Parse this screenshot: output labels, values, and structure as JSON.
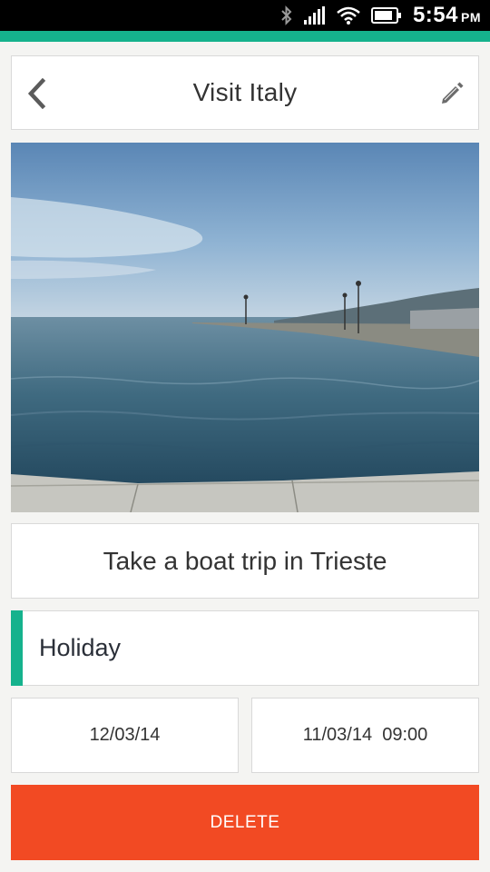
{
  "status_bar": {
    "time": "5:54",
    "ampm": "PM",
    "icons": [
      "bluetooth-icon",
      "signal-icon",
      "wifi-icon",
      "battery-icon"
    ]
  },
  "colors": {
    "accent": "#15b28d",
    "delete": "#f24a23",
    "background": "#f4f4f2"
  },
  "header": {
    "title": "Visit Italy",
    "back_icon": "chevron-left-icon",
    "edit_icon": "pencil-icon"
  },
  "task": {
    "title": "Take a boat trip in Trieste"
  },
  "category": {
    "label": "Holiday"
  },
  "dates": {
    "due_date": "12/03/14",
    "reminder": "11/03/14  09:00"
  },
  "actions": {
    "delete_label": "DELETE"
  }
}
